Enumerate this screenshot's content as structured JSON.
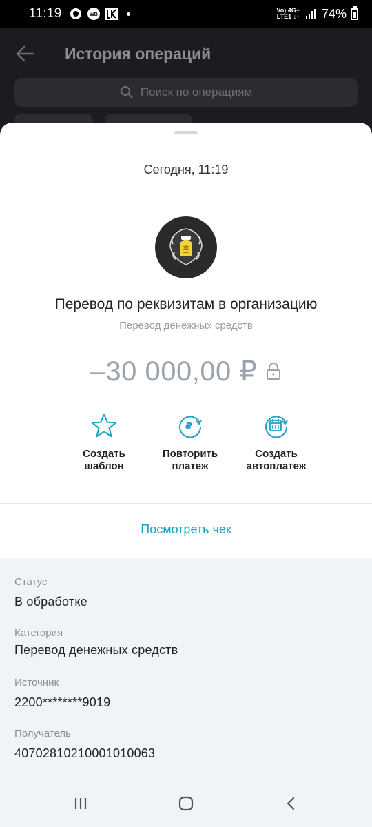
{
  "status_bar": {
    "time": "11:19",
    "network_top": "Vo) 4G+",
    "network_bottom": "LTE1 ↓↑",
    "battery": "74%"
  },
  "background_screen": {
    "title": "История операций",
    "search_placeholder": "Поиск по операциям"
  },
  "sheet": {
    "date": "Сегодня, 11:19",
    "title": "Перевод по реквизитам в организацию",
    "subtitle": "Перевод денежных средств",
    "amount": "–30 000,00 ₽",
    "actions": [
      {
        "label": "Создать шаблон",
        "icon": "star-icon"
      },
      {
        "label": "Повторить платеж",
        "icon": "repeat-payment-icon"
      },
      {
        "label": "Создать автоплатеж",
        "icon": "calendar-autopay-icon"
      }
    ],
    "receipt_link": "Посмотреть чек",
    "details": [
      {
        "label": "Статус",
        "value": "В обработке"
      },
      {
        "label": "Категория",
        "value": "Перевод денежных средств"
      },
      {
        "label": "Источник",
        "value": "2200********9019"
      },
      {
        "label": "Получатель",
        "value": "40702810210001010063"
      }
    ]
  },
  "colors": {
    "accent": "#1aa3c4",
    "amount": "#9da3ad",
    "details_bg": "#f1f4f7"
  }
}
